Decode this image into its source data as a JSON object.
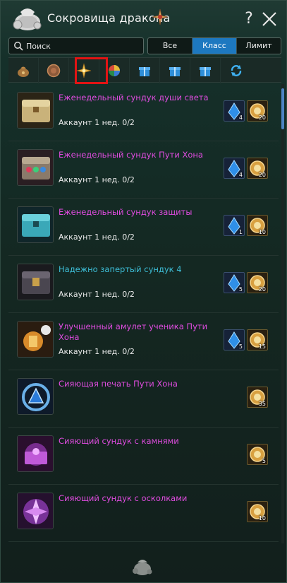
{
  "header": {
    "title": "Сокровища дракона"
  },
  "search": {
    "placeholder": "Поиск"
  },
  "filter": {
    "options": [
      "Все",
      "Класс",
      "Лимит"
    ],
    "selected": "Класс"
  },
  "tabs": [
    {
      "icon": "money-bag-icon"
    },
    {
      "icon": "bronze-coin-icon"
    },
    {
      "icon": "gold-star-emblem-icon"
    },
    {
      "icon": "rainbow-orb-icon"
    },
    {
      "icon": "gift-box-icon"
    },
    {
      "icon": "gift-box-icon"
    },
    {
      "icon": "gift-box-icon"
    },
    {
      "icon": "refresh-icon"
    }
  ],
  "items": [
    {
      "name": "Еженедельный сундук души света",
      "sub": "Аккаунт 1 нед. 0/2",
      "color": "magenta",
      "thumb": "gold-chest",
      "costs": [
        {
          "kind": "blue",
          "icon": "blue-crystal-icon",
          "num": "4"
        },
        {
          "kind": "gold",
          "icon": "gold-coin-icon",
          "num": "20"
        }
      ]
    },
    {
      "name": "Еженедельный сундук Пути Хона",
      "sub": "Аккаунт 1 нед. 0/2",
      "color": "magenta",
      "thumb": "jewel-chest",
      "costs": [
        {
          "kind": "blue",
          "icon": "blue-crystal-icon",
          "num": "4"
        },
        {
          "kind": "gold",
          "icon": "gold-coin-icon",
          "num": "20"
        }
      ]
    },
    {
      "name": "Еженедельный сундук защиты",
      "sub": "Аккаунт 1 нед. 0/2",
      "color": "magenta",
      "thumb": "teal-chest",
      "costs": [
        {
          "kind": "blue",
          "icon": "blue-crystal-icon",
          "num": "1"
        },
        {
          "kind": "gold",
          "icon": "gold-coin-icon",
          "num": "10"
        }
      ]
    },
    {
      "name": "Надежно запертый сундук 4",
      "sub": "Аккаунт 1 нед. 0/2",
      "color": "cyan",
      "thumb": "dark-chest",
      "costs": [
        {
          "kind": "blue",
          "icon": "blue-crystal-icon",
          "num": "5"
        },
        {
          "kind": "gold",
          "icon": "gold-coin-icon",
          "num": "20"
        }
      ]
    },
    {
      "name": "Улучшенный амулет ученика Пути Хона",
      "sub": "Аккаунт 1 нед. 0/2",
      "color": "magenta",
      "thumb": "amulet",
      "costs": [
        {
          "kind": "blue",
          "icon": "blue-crystal-icon",
          "num": "5"
        },
        {
          "kind": "gold",
          "icon": "gold-coin-icon",
          "num": "15"
        }
      ]
    },
    {
      "name": "Сияющая печать Пути Хона",
      "sub": "",
      "color": "magenta",
      "thumb": "seal",
      "costs": [
        {
          "kind": "gold",
          "icon": "gold-coin-icon",
          "num": "35"
        }
      ]
    },
    {
      "name": "Сияющий сундук с камнями",
      "sub": "",
      "color": "magenta",
      "thumb": "gem-chest",
      "costs": [
        {
          "kind": "gold",
          "icon": "gold-coin-icon",
          "num": "5"
        }
      ]
    },
    {
      "name": "Сияющий сундук с осколками",
      "sub": "",
      "color": "magenta",
      "thumb": "shard-chest",
      "costs": [
        {
          "kind": "gold",
          "icon": "gold-coin-icon",
          "num": "10"
        }
      ]
    }
  ],
  "colors": {
    "magenta": "#e04ce0",
    "cyan": "#3dbdd6",
    "accent": "#1d78c0",
    "highlight": "#e21414"
  }
}
